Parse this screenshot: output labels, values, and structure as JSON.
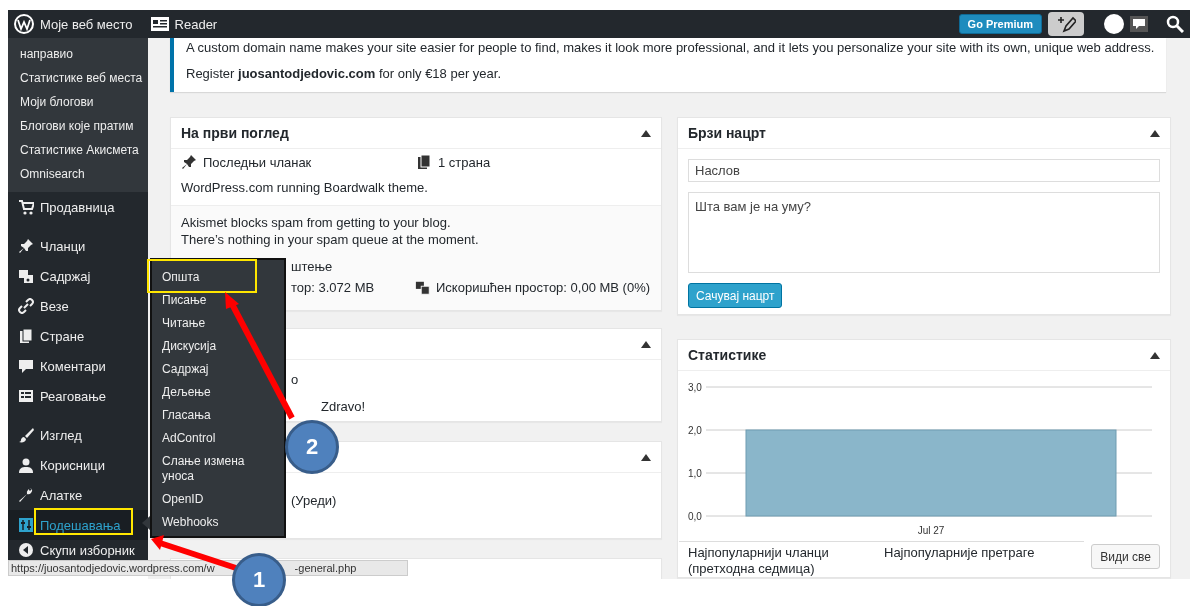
{
  "admin_bar": {
    "site_name": "Моје веб место",
    "reader": "Reader",
    "premium_button": "Go Premium"
  },
  "sidebar": {
    "submenu": [
      {
        "label": "направио"
      },
      {
        "label": "Статистике веб места"
      },
      {
        "label": "Моји блогови"
      },
      {
        "label": "Блогови које пратим"
      },
      {
        "label": "Статистике Акисмета"
      },
      {
        "label": "Omnisearch"
      }
    ],
    "sections": [
      {
        "items": [
          {
            "label": "Продавница",
            "selected": false
          }
        ]
      },
      {
        "items": [
          {
            "label": "Чланци",
            "selected": false
          },
          {
            "label": "Садржај",
            "selected": false
          },
          {
            "label": "Везе",
            "selected": false
          },
          {
            "label": "Стране",
            "selected": false
          },
          {
            "label": "Коментари",
            "selected": false
          },
          {
            "label": "Реаговање",
            "selected": false
          }
        ]
      },
      {
        "items": [
          {
            "label": "Изглед",
            "selected": false
          },
          {
            "label": "Корисници",
            "selected": false
          },
          {
            "label": "Алатке",
            "selected": false
          },
          {
            "label": "Подешавања",
            "selected": true
          },
          {
            "label": "Скупи изборник",
            "selected": false
          }
        ]
      }
    ]
  },
  "flyout": {
    "items": [
      {
        "label": "Општа"
      },
      {
        "label": "Писање"
      },
      {
        "label": "Читање"
      },
      {
        "label": "Дискусија"
      },
      {
        "label": "Садржај"
      },
      {
        "label": "Дељење"
      },
      {
        "label": "Гласања"
      },
      {
        "label": "AdControl"
      },
      {
        "label": "Слање измена уноса"
      },
      {
        "label": "OpenID"
      },
      {
        "label": "Webhooks"
      }
    ]
  },
  "notice": {
    "line_1": "A custom domain name makes your site easier for people to find, makes it look more professional, and it lets you personalize your site with its own, unique web address.",
    "line_2": "Register **juosantodjedovic.com** for only €18 per year."
  },
  "at_a_glance": {
    "title": "На први поглед",
    "latest_post": "Последњи чланак",
    "pages": "1 страна",
    "theme": "WordPress.com running Boardwalk theme.",
    "akismet": [
      "Akismet blocks spam from getting to your blog.",
      "There’s nothing in your spam queue at the moment."
    ],
    "partial": "штење",
    "storage": "тор: 3.072 MB",
    "used": "Искоришћен простор: 0,00 MB (0%)"
  },
  "card_2": {
    "lines": [
      "о",
      "Zdravo!"
    ]
  },
  "card_3": {
    "lines": [
      "(Уреди)"
    ]
  },
  "quick_draft": {
    "title": "Брзи нацрт",
    "title_placeholder": "Наслов",
    "content_placeholder": "Шта вам је на уму?",
    "button": "Сачувај нацрт"
  },
  "stats": {
    "title": "Статистике",
    "chart_data": {
      "type": "bar",
      "categories": [
        "Jul 27"
      ],
      "values": [
        2
      ],
      "ylim": [
        0,
        3
      ],
      "yticks": [
        {
          "value": 0,
          "label": "0,0"
        },
        {
          "value": 1,
          "label": "1,0"
        },
        {
          "value": 2,
          "label": "2,0"
        },
        {
          "value": 3,
          "label": "3,0"
        }
      ]
    },
    "top_posts": "Најпопуларнији чланци (претходна седмица)",
    "top_searches": "Најпопуларније претраге",
    "button": "Види све"
  },
  "status_bar": {
    "url_start": "https://juosantodjedovic.wordpress.com/w",
    "url_end": "-general.php"
  },
  "annotations": [
    {
      "label": "1"
    },
    {
      "label": "2"
    }
  ]
}
